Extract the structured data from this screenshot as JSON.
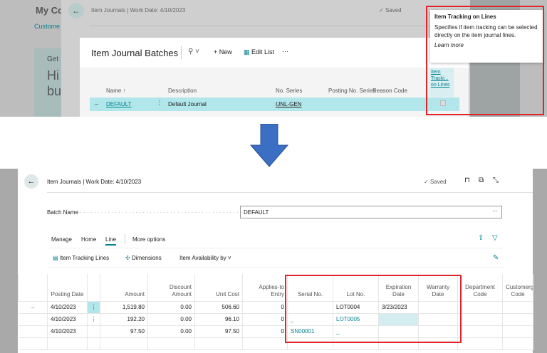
{
  "background": {
    "company": "My Co",
    "link": "Custome",
    "card_lines": [
      "Get",
      "Hi",
      "bu"
    ]
  },
  "behind_page": {
    "title": "Item Journals | Work Date: 4/10/2023",
    "saved": "Saved"
  },
  "dialog": {
    "title": "Item Journal Batches",
    "new": "New",
    "edit_list": "Edit List",
    "more": "···",
    "columns": [
      "Name ↑",
      "Description",
      "No. Series",
      "Posting No. Series",
      "Reason Code",
      "Item Tracki... on Lines"
    ],
    "row": {
      "name": "DEFAULT",
      "description": "Default Journal",
      "no_series": "IJNL-GEN"
    }
  },
  "tooltip": {
    "title": "Item Tracking on Lines",
    "body": "Specifies if item tracking can be selected directly on the item journal lines.",
    "link": "Learn more"
  },
  "page": {
    "title": "Item Journals | Work Date: 4/10/2023",
    "saved": "Saved",
    "batch_label": "Batch Name",
    "batch_value": "DEFAULT",
    "tabs": [
      "Manage",
      "Home",
      "Line",
      "More options"
    ],
    "actions": [
      "Item Tracking Lines",
      "Dimensions",
      "Item Availability by"
    ],
    "columns": [
      "",
      "Posting Date",
      "",
      "Amount",
      "Discount Amount",
      "Unit Cost",
      "Applies-to Entry",
      "Serial No.",
      "Lot No.",
      "Expiration Date",
      "Warranty Date",
      "Department Code",
      "Customergr Code"
    ],
    "rows": [
      [
        "→",
        "4/10/2023",
        "⋮",
        "1,519.80",
        "0.00",
        "506.60",
        "0",
        "",
        "LOT0004",
        "3/23/2023",
        "",
        "",
        ""
      ],
      [
        "",
        "4/10/2023",
        "⋮",
        "192.20",
        "0.00",
        "96.10",
        "0",
        "_",
        "LOT0005",
        "",
        "",
        "",
        ""
      ],
      [
        "",
        "4/10/2023",
        "",
        "97.50",
        "0.00",
        "97.50",
        "0",
        "SN00001",
        "_",
        "",
        "",
        "",
        ""
      ],
      [
        "",
        "",
        "",
        "",
        "",
        "",
        "",
        "",
        "",
        "",
        "",
        "",
        ""
      ]
    ]
  },
  "colors": {
    "accent": "#00838f",
    "highlight": "#b1e6ea",
    "red": "#e0242b",
    "arrow": "#3a6fc4"
  }
}
